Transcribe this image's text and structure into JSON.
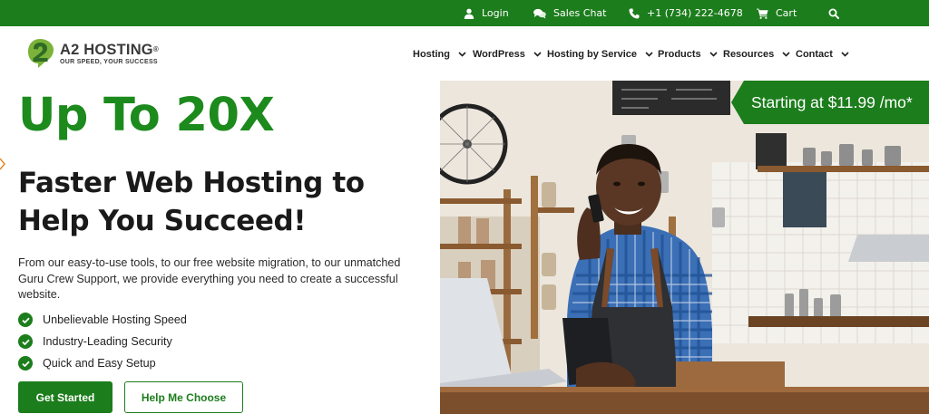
{
  "topbar": {
    "login": {
      "label": "Login",
      "icon": "user-icon"
    },
    "sales_chat": {
      "label": "Sales Chat",
      "icon": "chat-icon"
    },
    "phone": {
      "label": "+1 (734) 222-4678",
      "icon": "phone-icon"
    },
    "cart": {
      "label": "Cart",
      "icon": "cart-icon"
    },
    "search": {
      "icon": "search-icon"
    }
  },
  "brand": {
    "name": "A2 HOSTING",
    "registered": "®",
    "tagline": "OUR SPEED, YOUR SUCCESS",
    "logo_icon": "a2-logo-icon"
  },
  "nav": {
    "items": [
      {
        "label": "Hosting"
      },
      {
        "label": "WordPress"
      },
      {
        "label": "Hosting by Service"
      },
      {
        "label": "Products"
      },
      {
        "label": "Resources"
      },
      {
        "label": "Contact"
      }
    ]
  },
  "hero": {
    "title": "Up To 20X",
    "subtitle_line1": "Faster Web Hosting to",
    "subtitle_line2": "Help You Succeed!",
    "description": "From our easy-to-use tools, to our free website migration, to our unmatched Guru Crew Support, we provide everything you need to create a successful website.",
    "features": [
      "Unbelievable Hosting Speed",
      "Industry-Leading Security",
      "Quick and Easy Setup"
    ],
    "primary_button": "Get Started",
    "secondary_button": "Help Me Choose",
    "price_badge": "Starting at $11.99 /mo*"
  },
  "colors": {
    "brand_green": "#1c7d1c",
    "headline_green": "#1c8a1c",
    "text_dark": "#1a1a1a"
  }
}
